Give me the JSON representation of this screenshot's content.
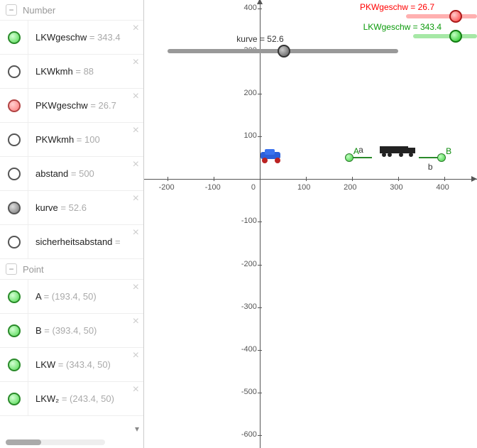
{
  "sections": {
    "number": {
      "title": "Number"
    },
    "point": {
      "title": "Point"
    }
  },
  "numberItems": [
    {
      "color": "green",
      "name": "LKWgeschw",
      "eq": " = ",
      "val": "343.4"
    },
    {
      "color": "white",
      "name": "LKWkmh",
      "eq": " = ",
      "val": "88"
    },
    {
      "color": "red",
      "name": "PKWgeschw",
      "eq": " = ",
      "val": "26.7"
    },
    {
      "color": "white",
      "name": "PKWkmh",
      "eq": " = ",
      "val": "100"
    },
    {
      "color": "white",
      "name": "abstand",
      "eq": " = ",
      "val": "500"
    },
    {
      "color": "gray",
      "name": "kurve",
      "eq": " = ",
      "val": "52.6"
    },
    {
      "color": "white",
      "name": "sicherheitsabstand",
      "eq": " = ",
      "val": ""
    }
  ],
  "pointItems": [
    {
      "color": "green",
      "name": "A",
      "eq": " = ",
      "val": "(193.4, 50)"
    },
    {
      "color": "green",
      "name": "B",
      "eq": " = ",
      "val": "(393.4, 50)"
    },
    {
      "color": "green",
      "name": "LKW",
      "eq": " = ",
      "val": "(343.4, 50)"
    },
    {
      "color": "green",
      "name": "LKW₂",
      "eq": " = ",
      "val": "(243.4, 50)"
    }
  ],
  "chart_data": {
    "type": "scatter",
    "title": "",
    "xlabel": "",
    "ylabel": "",
    "xlim": [
      -250,
      470
    ],
    "ylim": [
      -630,
      420
    ],
    "x_ticks": [
      -200,
      -100,
      0,
      100,
      200,
      300,
      400
    ],
    "y_ticks": [
      -600,
      -500,
      -400,
      -300,
      -200,
      -100,
      100,
      200,
      300,
      400
    ],
    "sliders": [
      {
        "name": "kurve",
        "value": 52.6,
        "range": [
          -200,
          300
        ],
        "y": 300,
        "color": "#808080"
      },
      {
        "name": "PKWgeschw",
        "value": 26.7,
        "color": "#ff0000"
      },
      {
        "name": "LKWgeschw",
        "value": 343.4,
        "color": "#00b400"
      }
    ],
    "points": [
      {
        "label": "A",
        "x": 193.4,
        "y": 50,
        "color": "green"
      },
      {
        "label": "B",
        "x": 393.4,
        "y": 50,
        "color": "green"
      }
    ],
    "segments": [
      {
        "label": "a",
        "from": [
          193.4,
          50
        ],
        "to": [
          243.4,
          50
        ]
      },
      {
        "label": "b",
        "from": [
          343.4,
          50
        ],
        "to": [
          393.4,
          50
        ]
      }
    ],
    "vehicles": {
      "car_pkw": {
        "x": 26.7,
        "y": 50
      },
      "truck_lkw": {
        "x": 300,
        "y": 60
      }
    },
    "slider_labels": {
      "kurve": "kurve = 52.6",
      "pkw": "PKWgeschw = 26.7",
      "lkw": "LKWgeschw = 343.4"
    }
  }
}
